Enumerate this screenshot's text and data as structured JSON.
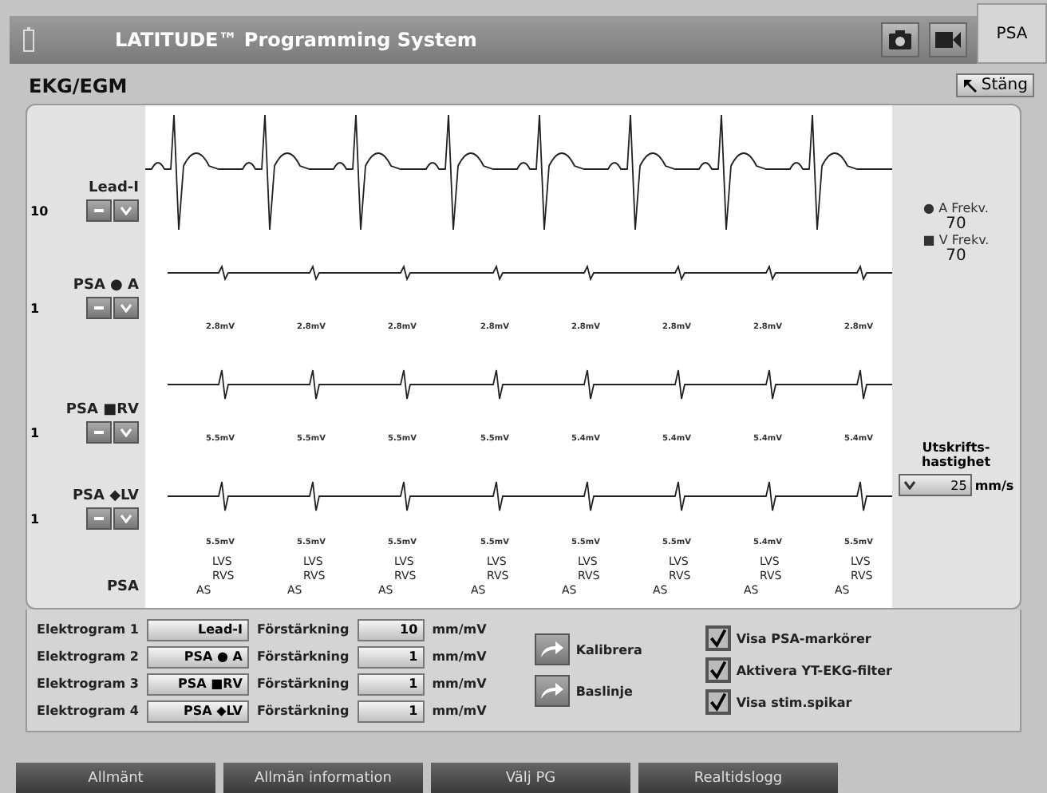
{
  "title_bar": {
    "title": "LATITUDE™ Programming System",
    "mode_button": "PSA"
  },
  "panel": {
    "title": "EKG/EGM",
    "close_button": "Stäng"
  },
  "channels": [
    {
      "kind": "surface",
      "label": "Lead-I",
      "gain": "10"
    },
    {
      "kind": "atrial",
      "label": "PSA ● A",
      "gain": "1",
      "amplitudes": [
        "2.8mV",
        "2.8mV",
        "2.8mV",
        "2.8mV",
        "2.8mV",
        "2.8mV",
        "2.8mV",
        "2.8mV"
      ]
    },
    {
      "kind": "ventricular",
      "label": "PSA ■RV",
      "gain": "1",
      "amplitudes": [
        "5.5mV",
        "5.5mV",
        "5.5mV",
        "5.5mV",
        "5.4mV",
        "5.4mV",
        "5.4mV",
        "5.4mV"
      ]
    },
    {
      "kind": "ventricular",
      "label": "PSA ◆LV",
      "gain": "1",
      "amplitudes": [
        "5.5mV",
        "5.5mV",
        "5.5mV",
        "5.5mV",
        "5.5mV",
        "5.5mV",
        "5.4mV",
        "5.5mV"
      ]
    }
  ],
  "markers": {
    "label": "PSA",
    "beats": [
      {
        "top": "LVS",
        "middle": "RVS",
        "bottom": "AS"
      },
      {
        "top": "LVS",
        "middle": "RVS",
        "bottom": "AS"
      },
      {
        "top": "LVS",
        "middle": "RVS",
        "bottom": "AS"
      },
      {
        "top": "LVS",
        "middle": "RVS",
        "bottom": "AS"
      },
      {
        "top": "LVS",
        "middle": "RVS",
        "bottom": "AS"
      },
      {
        "top": "LVS",
        "middle": "RVS",
        "bottom": "AS"
      },
      {
        "top": "LVS",
        "middle": "RVS",
        "bottom": "AS"
      },
      {
        "top": "LVS",
        "middle": "RVS",
        "bottom": "AS"
      }
    ]
  },
  "rates": [
    {
      "label": "A Frekv.",
      "symbol": "●",
      "value": "70"
    },
    {
      "label": "V Frekv.",
      "symbol": "■",
      "value": "70"
    }
  ],
  "print_speed": {
    "label": "Utskrifts-\nhastighet",
    "value": "25",
    "unit": "mm/s"
  },
  "electrograms": [
    {
      "label": "Elektrogram 1",
      "source": "Lead-I",
      "gain_label": "Förstärkning",
      "gain": "10",
      "unit": "mm/mV"
    },
    {
      "label": "Elektrogram 2",
      "source": "PSA ● A",
      "gain_label": "Förstärkning",
      "gain": "1",
      "unit": "mm/mV"
    },
    {
      "label": "Elektrogram 3",
      "source": "PSA ■RV",
      "gain_label": "Förstärkning",
      "gain": "1",
      "unit": "mm/mV"
    },
    {
      "label": "Elektrogram 4",
      "source": "PSA ◆LV",
      "gain_label": "Förstärkning",
      "gain": "1",
      "unit": "mm/mV"
    }
  ],
  "actions": [
    "Kalibrera",
    "Baslinje"
  ],
  "options": [
    {
      "label": "Visa PSA-markörer",
      "checked": true
    },
    {
      "label": "Aktivera YT-EKG-filter",
      "checked": true
    },
    {
      "label": "Visa stim.spikar",
      "checked": true
    }
  ],
  "tabs": [
    {
      "label": "Allmänt",
      "selected": false
    },
    {
      "label": "Allmän information",
      "selected": false
    },
    {
      "label": "Välj PG",
      "selected": false
    },
    {
      "label": "Realtidslogg",
      "selected": false
    }
  ]
}
